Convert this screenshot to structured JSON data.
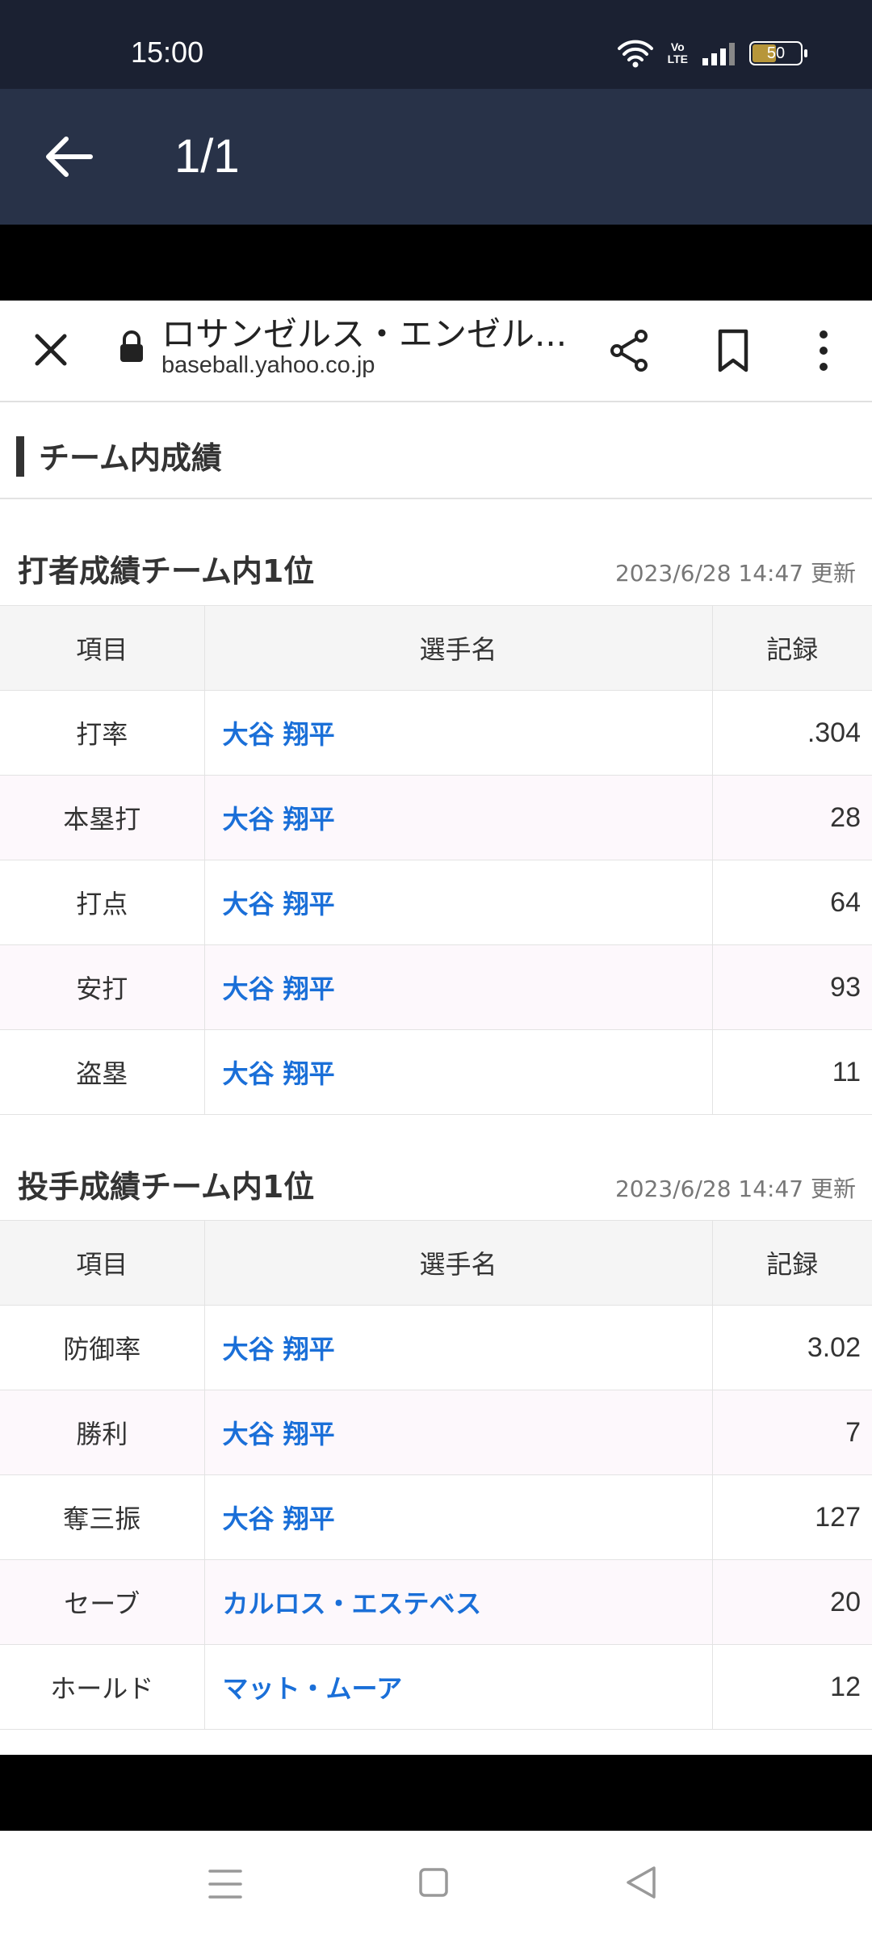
{
  "status_bar": {
    "time": "15:00",
    "network_label": "Vo\nLTE",
    "battery_level": "50",
    "battery_fraction": 0.5
  },
  "viewer": {
    "title": "1/1"
  },
  "browser": {
    "page_title": "ロサンゼルス・エンゼル...",
    "url": "baseball.yahoo.co.jp"
  },
  "section": {
    "title": "チーム内成績"
  },
  "batting": {
    "title": "打者成績チーム内1位",
    "updated": "2023/6/28 14:47 更新",
    "headers": [
      "項目",
      "選手名",
      "記録"
    ],
    "rows": [
      {
        "item": "打率",
        "player": "大谷 翔平",
        "record": ".304"
      },
      {
        "item": "本塁打",
        "player": "大谷 翔平",
        "record": "28"
      },
      {
        "item": "打点",
        "player": "大谷 翔平",
        "record": "64"
      },
      {
        "item": "安打",
        "player": "大谷 翔平",
        "record": "93"
      },
      {
        "item": "盗塁",
        "player": "大谷 翔平",
        "record": "11"
      }
    ]
  },
  "pitching": {
    "title": "投手成績チーム内1位",
    "updated": "2023/6/28 14:47 更新",
    "headers": [
      "項目",
      "選手名",
      "記録"
    ],
    "rows": [
      {
        "item": "防御率",
        "player": "大谷 翔平",
        "record": "3.02"
      },
      {
        "item": "勝利",
        "player": "大谷 翔平",
        "record": "7"
      },
      {
        "item": "奪三振",
        "player": "大谷 翔平",
        "record": "127"
      },
      {
        "item": "セーブ",
        "player": "カルロス・エステベス",
        "record": "20"
      },
      {
        "item": "ホールド",
        "player": "マット・ムーア",
        "record": "12"
      }
    ]
  },
  "colors": {
    "player_link": "#1a6fd8",
    "header_bg": "#283248",
    "status_bg": "#1b2132"
  },
  "icons": {
    "back": "arrow-left-icon",
    "close": "close-icon",
    "lock": "lock-icon",
    "share": "share-icon",
    "bookmark": "bookmark-icon",
    "more": "more-vertical-icon",
    "wifi": "wifi-icon",
    "signal": "signal-icon",
    "battery": "battery-icon",
    "nav_menu": "menu-icon",
    "nav_home": "home-square-icon",
    "nav_back": "back-triangle-icon"
  }
}
